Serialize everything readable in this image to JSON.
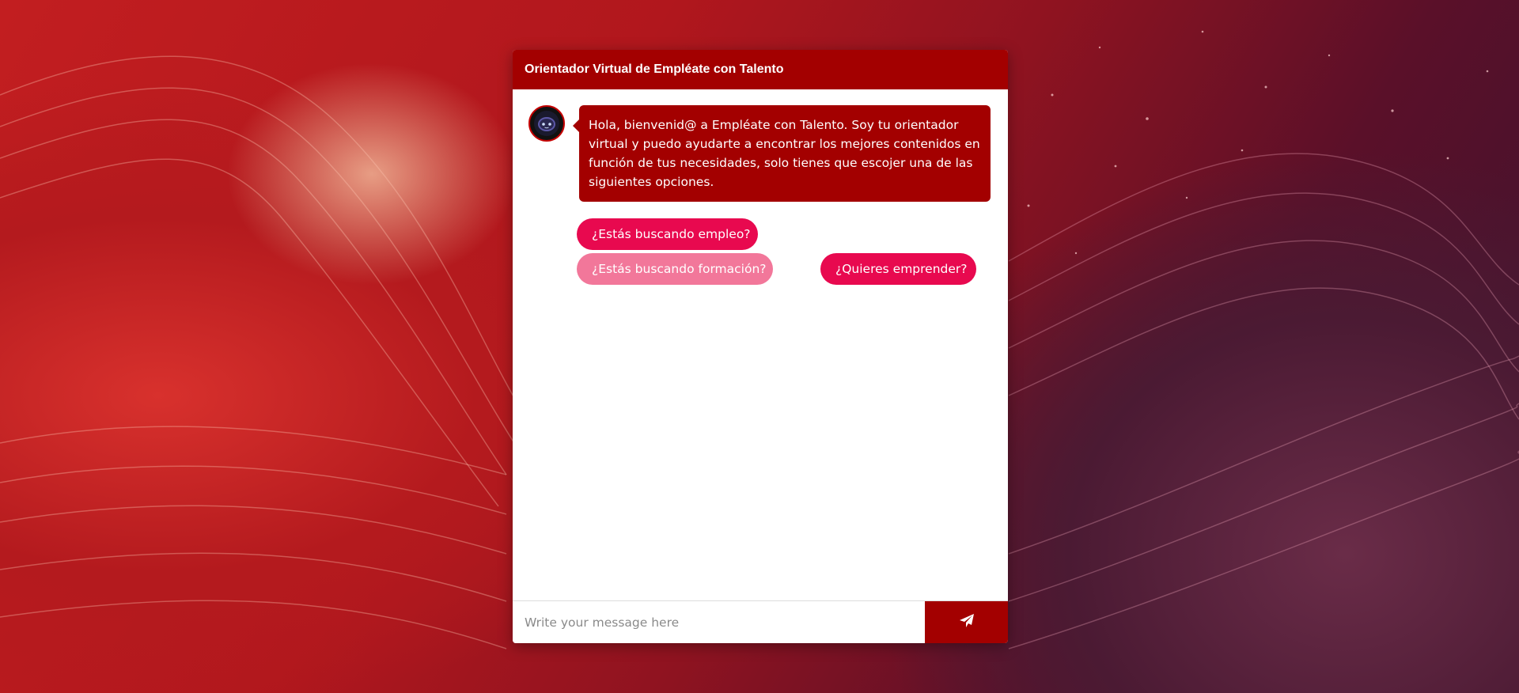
{
  "chat": {
    "title": "Orientador Virtual de Empléate con Talento",
    "bot_avatar_icon": "robot-icon",
    "welcome_message": "Hola, bienvenid@ a Empléate con Talento. Soy tu orientador virtual y puedo ayudarte a encontrar los mejores contenidos en función de tus necesidades, solo tienes que escojer una de las siguientes opciones.",
    "options": [
      {
        "label": "¿Estás buscando empleo?",
        "color": "#e8094f"
      },
      {
        "label": "¿Estás buscando formación?",
        "color": "#f2779a"
      },
      {
        "label": "¿Quieres emprender?",
        "color": "#e8094f"
      }
    ],
    "input": {
      "placeholder": "Write your message here",
      "value": ""
    },
    "send_icon": "paper-plane-icon"
  },
  "colors": {
    "header": "#a30000",
    "bot_bubble": "#a30000",
    "option_primary": "#e8094f",
    "option_hover": "#f2779a",
    "send_button": "#a30000"
  }
}
